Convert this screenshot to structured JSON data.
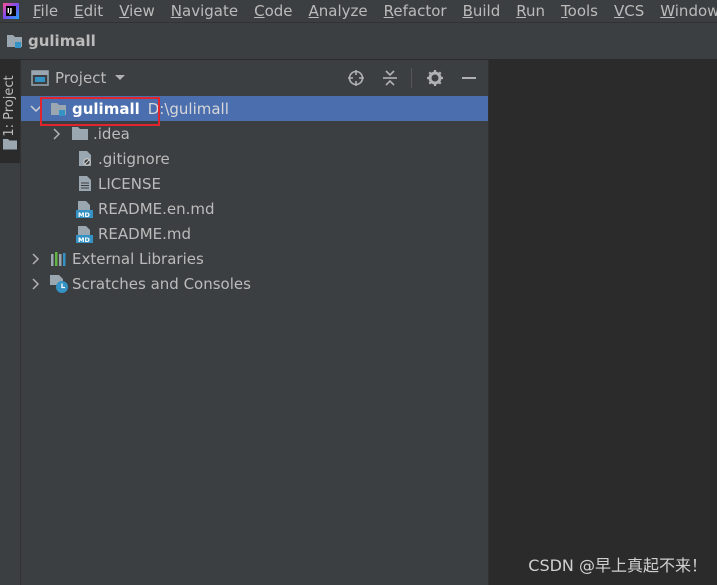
{
  "menu": {
    "items": [
      "File",
      "Edit",
      "View",
      "Navigate",
      "Code",
      "Analyze",
      "Refactor",
      "Build",
      "Run",
      "Tools",
      "VCS",
      "Window"
    ]
  },
  "navbar": {
    "project_name": "gulimall"
  },
  "toolstrip": {
    "tab_label": "1: Project"
  },
  "panel": {
    "title": "Project",
    "tools": [
      "locate-icon",
      "collapse-icon",
      "gear-icon",
      "minimize-icon"
    ]
  },
  "tree": {
    "root": {
      "name": "gulimall",
      "path": "D:\\gulimall"
    },
    "items": [
      {
        "name": ".idea",
        "icon": "folder-icon"
      },
      {
        "name": ".gitignore",
        "icon": "gitignore-file-icon"
      },
      {
        "name": "LICENSE",
        "icon": "text-file-icon"
      },
      {
        "name": "README.en.md",
        "icon": "markdown-file-icon"
      },
      {
        "name": "README.md",
        "icon": "markdown-file-icon"
      }
    ],
    "external_libraries": "External Libraries",
    "scratches": "Scratches and Consoles"
  },
  "watermark": "CSDN @早上真起不来！",
  "colors": {
    "selection": "#4b6eaf",
    "panel_bg": "#3c3f41",
    "editor_bg": "#2b2b2b",
    "highlight": "#e0252c"
  }
}
